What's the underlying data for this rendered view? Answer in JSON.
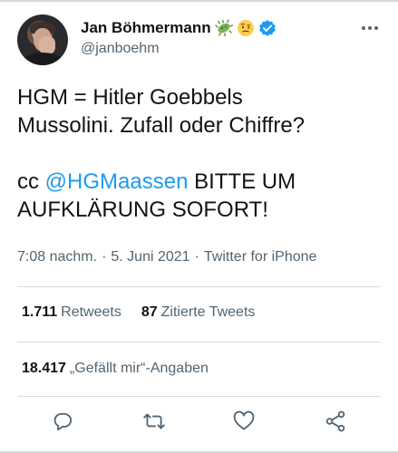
{
  "author": {
    "display_name": "Jan Böhmermann",
    "handle": "@janboehm",
    "name_emojis": [
      "microbe-emoji",
      "face-with-raised-eyebrow-emoji"
    ],
    "verified": true
  },
  "tweet": {
    "text_lines": [
      "HGM = Hitler Goebbels",
      "Mussolini. Zufall oder Chiffre?"
    ],
    "cc_prefix": "cc ",
    "mention": "@HGMaassen",
    "cc_suffix_line1": " BITTE UM",
    "cc_line2": "AUFKLÄRUNG SOFORT!"
  },
  "meta": {
    "time": "7:08 nachm.",
    "separator": "·",
    "date": "5. Juni 2021",
    "source": "Twitter for iPhone"
  },
  "stats": {
    "retweets": {
      "count": "1.711",
      "label": "Retweets"
    },
    "quotes": {
      "count": "87",
      "label": "Zitierte Tweets"
    },
    "likes": {
      "count": "18.417",
      "label": "„Gefällt mir“-Angaben"
    }
  },
  "actions": [
    "reply-icon",
    "retweet-icon",
    "like-icon",
    "share-icon"
  ],
  "colors": {
    "link": "#1d9bf0",
    "secondary_text": "#536471",
    "primary_text": "#0f1419",
    "verified_badge": "#1d9bf0"
  }
}
